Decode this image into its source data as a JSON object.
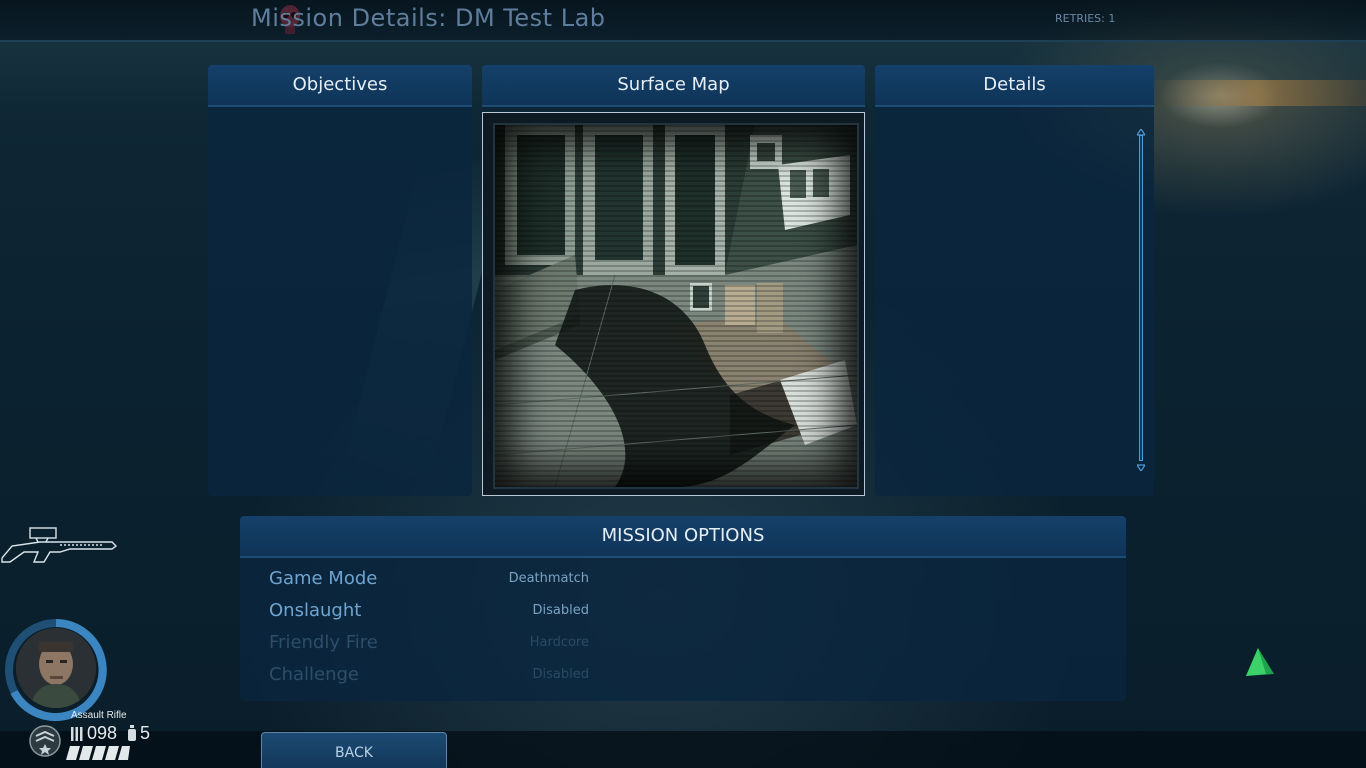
{
  "header": {
    "title": "Mission Details: DM Test Lab",
    "retries": "RETRIES: 1"
  },
  "panels": {
    "objectives": {
      "title": "Objectives"
    },
    "surface_map": {
      "title": "Surface Map",
      "image_icon": "map-preview-lab-room"
    },
    "details": {
      "title": "Details"
    }
  },
  "mission_options": {
    "title": "MISSION OPTIONS",
    "rows": [
      {
        "label": "Game Mode",
        "value": "Deathmatch",
        "state": "active"
      },
      {
        "label": "Onslaught",
        "value": "Disabled",
        "state": "active"
      },
      {
        "label": "Friendly Fire",
        "value": "Hardcore",
        "state": "dim"
      },
      {
        "label": "Challenge",
        "value": "Disabled",
        "state": "dim"
      }
    ]
  },
  "footer": {
    "back_label": "BACK"
  },
  "hud": {
    "weapon_name": "Assault Rifle",
    "ammo": "098",
    "grenades": "5",
    "health_segments": 5,
    "icons": [
      "rifle-icon",
      "marine-portrait",
      "rank-icon",
      "ammo-icon",
      "grenade-icon",
      "waypoint-icon",
      "skull-icon"
    ]
  },
  "colors": {
    "panel_header": "#15406a",
    "panel_body": "#0a263e",
    "active_text": "#6ea4cf",
    "dim_text": "#2d4e68",
    "accent_blue": "#4d9bd6"
  }
}
